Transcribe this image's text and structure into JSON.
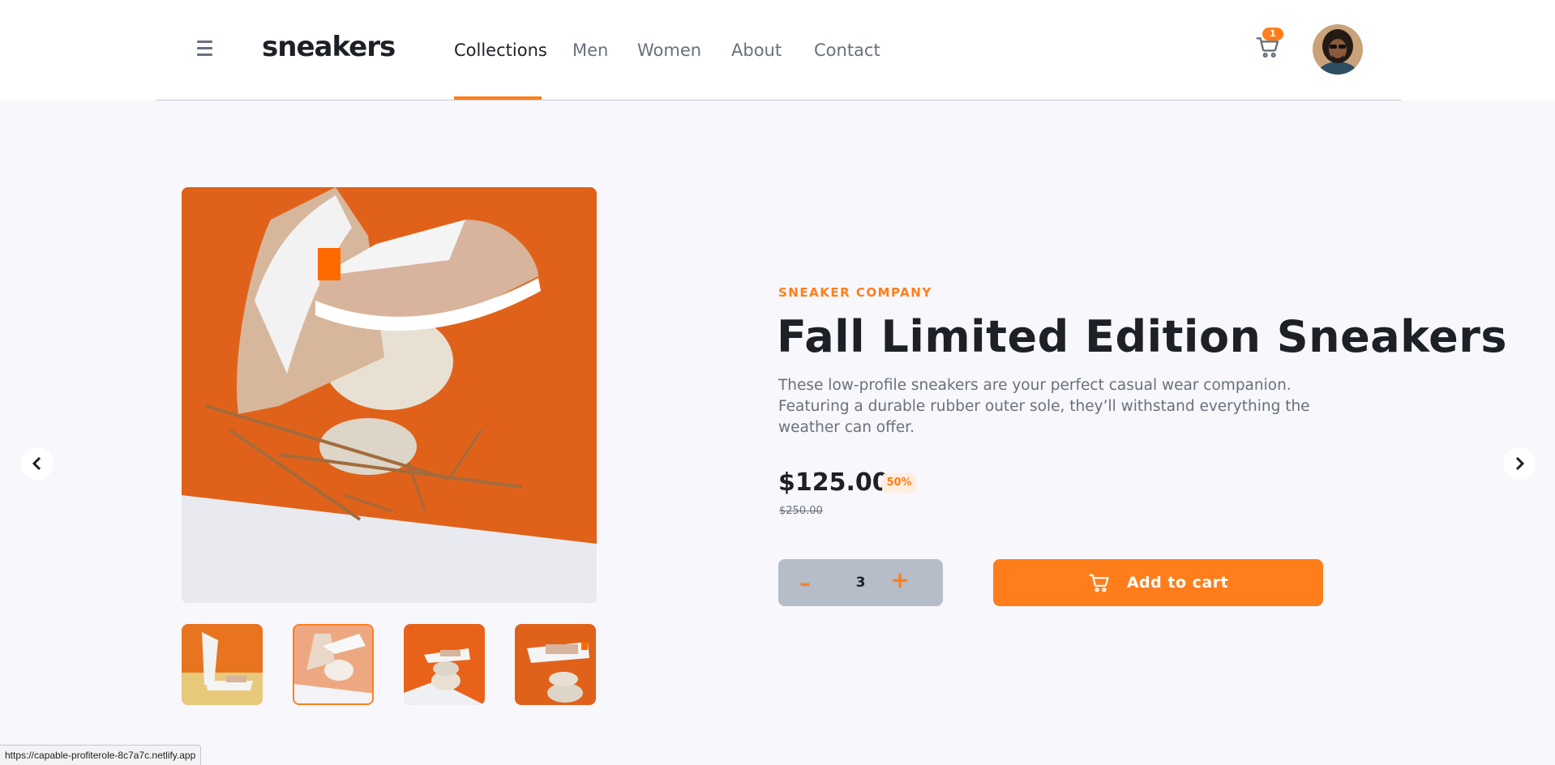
{
  "brand": {
    "logo": "sneakers"
  },
  "nav": {
    "items": [
      {
        "label": "Collections",
        "active": true
      },
      {
        "label": "Men",
        "active": false
      },
      {
        "label": "Women",
        "active": false
      },
      {
        "label": "About",
        "active": false
      },
      {
        "label": "Contact",
        "active": false
      }
    ]
  },
  "cart": {
    "count": "1"
  },
  "product": {
    "company": "SNEAKER COMPANY",
    "title": "Fall Limited Edition Sneakers",
    "description": "These low-profile sneakers are your perfect casual wear companion. Featuring a durable rubber outer sole, they’ll withstand everything the weather can offer.",
    "price": "$125.00",
    "discount": "50%",
    "original_price": "$250.00",
    "quantity": "3",
    "minus_label": "–",
    "plus_label": "+",
    "add_to_cart_label": "Add to cart",
    "thumbnails_count": 4,
    "selected_thumbnail": 2
  },
  "status_bar": {
    "url": "https://capable-profiterole-8c7a7c.netlify.app"
  },
  "colors": {
    "accent": "#ff7e1b",
    "accent_light": "#ffede0",
    "text_dark": "#1d2026",
    "text_muted": "#69707d",
    "background": "#f7f7fc"
  },
  "icons": {
    "menu": "hamburger-icon",
    "cart": "cart-icon",
    "prev": "chevron-left-icon",
    "next": "chevron-right-icon"
  }
}
